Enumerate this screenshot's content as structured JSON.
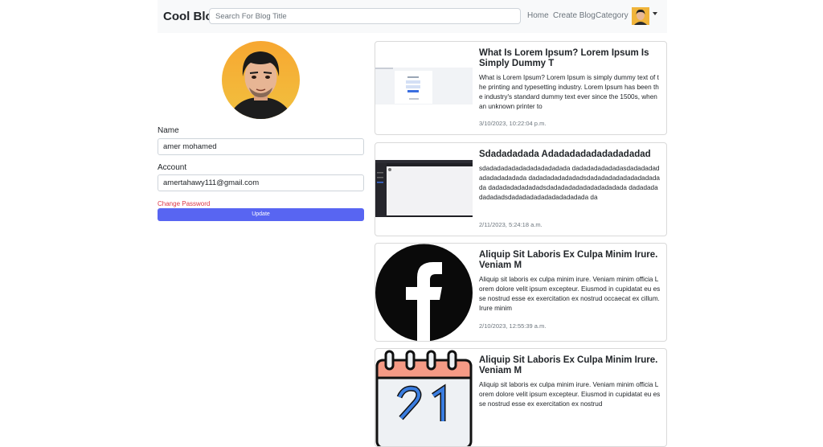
{
  "navbar": {
    "brand": "Cool Blog",
    "search_placeholder": "Search For Blog Title",
    "links": [
      "Home",
      "Create Blog",
      "Category"
    ]
  },
  "profile": {
    "name_label": "Name",
    "name_value": "amer mohamed",
    "account_label": "Account",
    "account_value": "amertahawy111@gmail.com",
    "change_password": "Change Password",
    "update_label": "Update"
  },
  "posts": [
    {
      "title": "What Is Lorem Ipsum? Lorem Ipsum Is Simply Dummy T",
      "excerpt": "What is Lorem Ipsum? Lorem Ipsum is simply dummy text of the printing and typesetting industry. Lorem Ipsum has been the industry's standard dummy text ever since the 1500s, when an unknown printer to",
      "date": "3/10/2023, 10:22:04 p.m.",
      "image": "screenshot-login-page"
    },
    {
      "title": "Sdadadadada Adadadadadadadadadad",
      "excerpt": "sdadadadadadadadadadadada dadadadadadadasdadadadadadadadadadada dadadadadadadadsdadadadadadadadadadada dadadadadadadadsdadadadadadadadadadada dadadadadadadadsdadadadadadadadadadada da",
      "date": "2/11/2023, 5:24:18 a.m.",
      "image": "screenshot-dark-app"
    },
    {
      "title": "Aliquip Sit Laboris Ex Culpa Minim Irure. Veniam M",
      "excerpt": "Aliquip sit laboris ex culpa minim irure. Veniam minim officia Lorem dolore velit ipsum excepteur. Eiusmod in cupidatat eu esse nostrud esse ex exercitation ex nostrud occaecat ex cillum. Irure minim",
      "date": "2/10/2023, 12:55:39 a.m.",
      "image": "facebook-logo"
    },
    {
      "title": "Aliquip Sit Laboris Ex Culpa Minim Irure. Veniam M",
      "excerpt": "Aliquip sit laboris ex culpa minim irure. Veniam minim officia Lorem dolore velit ipsum excepteur. Eiusmod in cupidatat eu esse nostrud esse ex exercitation ex nostrud",
      "date": "",
      "image": "calendar-icon"
    }
  ]
}
